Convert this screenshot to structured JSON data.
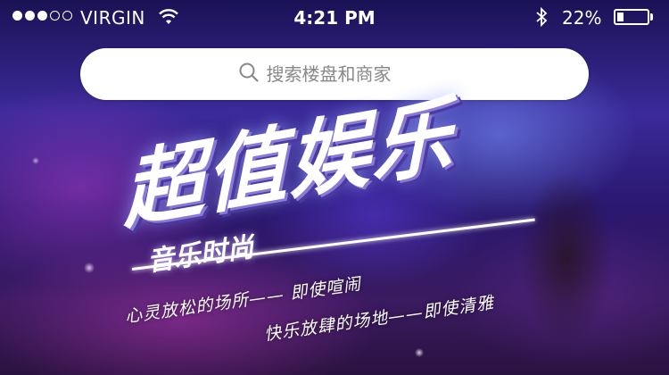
{
  "status_bar": {
    "signal_dots_filled": 3,
    "signal_dots_total": 5,
    "carrier": "VIRGIN",
    "time": "4:21 PM",
    "battery_percent_text": "22%",
    "battery_level": 0.22
  },
  "search": {
    "placeholder": "搜索楼盘和商家"
  },
  "banner": {
    "headline": "超值娱乐",
    "subtitle": "音乐时尚",
    "tagline_1": "心灵放松的场所—— 即使喧闹",
    "tagline_2": "快乐放肆的场地——即使清雅"
  },
  "colors": {
    "background": "#2a1870",
    "search_bg": "#ffffff",
    "text": "#ffffff"
  }
}
